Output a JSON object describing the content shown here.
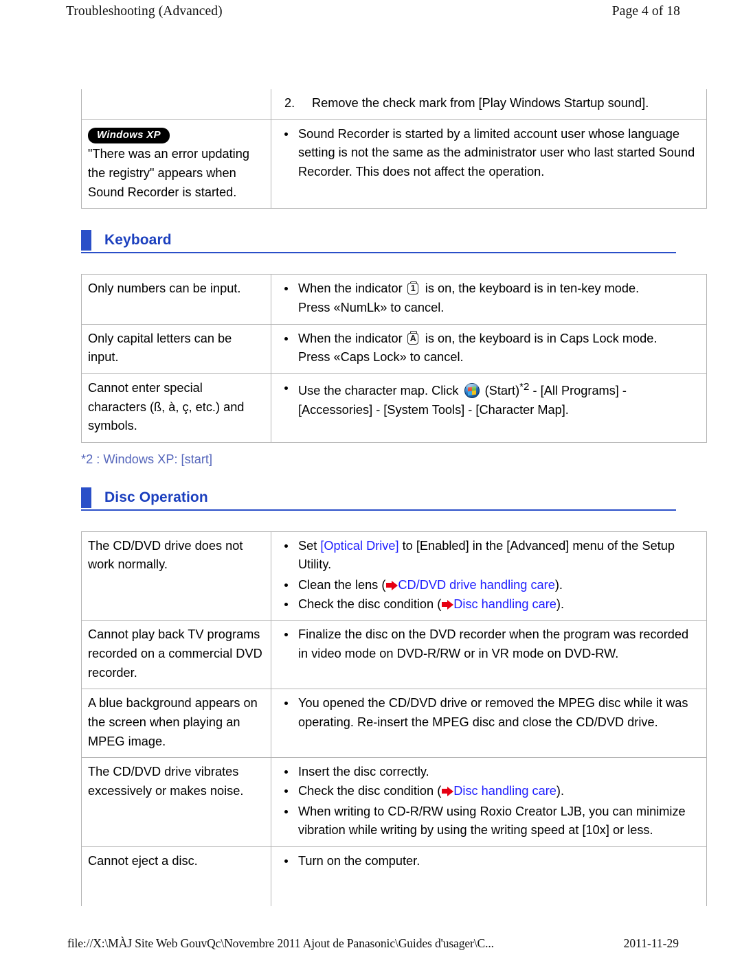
{
  "header": {
    "title": "Troubleshooting (Advanced)",
    "page_label": "Page 4 of 18"
  },
  "footer": {
    "path": "file://X:\\MÀJ Site Web GouvQc\\Novembre 2011 Ajout de Panasonic\\Guides d'usager\\C...",
    "date": "2011-11-29"
  },
  "sound_table": {
    "row1": {
      "symptom": "",
      "number": "2.",
      "fix": "Remove the check mark from [Play Windows Startup sound]."
    },
    "row2": {
      "badge": "Windows XP",
      "symptom": "\"There was an error updating the registry\" appears when Sound Recorder is started.",
      "fix": "Sound Recorder is started by a limited account user whose language setting is not the same as the administrator user who last started Sound Recorder. This does not affect the operation."
    }
  },
  "keyboard_section": {
    "heading": "Keyboard",
    "rows": [
      {
        "symptom": "Only numbers can be input.",
        "fix_pre": "When the indicator",
        "indicator": "1",
        "fix_post": "is on, the keyboard is in ten-key mode.",
        "fix_line2": "Press «NumLk» to cancel."
      },
      {
        "symptom": "Only capital letters can be input.",
        "fix_pre": "When the indicator",
        "indicator": "A",
        "fix_post": "is on, the keyboard is in Caps Lock mode.",
        "fix_line2": "Press «Caps Lock» to cancel."
      },
      {
        "symptom": "Cannot enter special characters (ß, à, ç, etc.) and symbols.",
        "fix_pre": "Use the character map. Click",
        "fix_start": "(Start)",
        "fix_sup": "*2",
        "fix_post": " - [All Programs] - [Accessories] - [System Tools] - [Character Map].",
        "fix_line2": ""
      }
    ],
    "footnote": "*2 : Windows XP: [start]"
  },
  "disc_section": {
    "heading": "Disc Operation",
    "rows": [
      {
        "symptom": "The CD/DVD drive does not work normally.",
        "bullets": [
          {
            "kind": "link-inline",
            "pre": "Set ",
            "link": "[Optical Drive]",
            "post": " to [Enabled] in the [Advanced] menu of the Setup Utility."
          },
          {
            "kind": "jump",
            "pre": "Clean the lens (",
            "link": "CD/DVD drive handling care",
            "post": ")."
          },
          {
            "kind": "jump",
            "pre": "Check the disc condition (",
            "link": "Disc handling care",
            "post": ")."
          }
        ]
      },
      {
        "symptom": "Cannot play back TV programs recorded on a commercial DVD recorder.",
        "bullets": [
          {
            "kind": "plain",
            "text": "Finalize the disc on the DVD recorder when the program was recorded in video mode on DVD-R/RW or in VR mode on DVD-RW."
          }
        ]
      },
      {
        "symptom": "A blue background appears on the screen when playing an MPEG image.",
        "bullets": [
          {
            "kind": "plain",
            "text": "You opened the CD/DVD drive or removed the MPEG disc while it was operating. Re-insert the MPEG disc and close the CD/DVD drive."
          }
        ]
      },
      {
        "symptom": "The CD/DVD drive vibrates excessively or makes noise.",
        "bullets": [
          {
            "kind": "plain",
            "text": "Insert the disc correctly."
          },
          {
            "kind": "jump",
            "pre": "Check the disc condition (",
            "link": "Disc handling care",
            "post": ")."
          },
          {
            "kind": "plain",
            "text": "When writing to CD-R/RW using Roxio Creator LJB, you can minimize vibration while writing by using the writing speed at [10x] or less."
          }
        ]
      },
      {
        "symptom": "Cannot eject a disc.",
        "bullets": [
          {
            "kind": "plain",
            "text": "Turn on the computer."
          }
        ]
      }
    ]
  },
  "colors": {
    "heading_blue": "#2a4fc8",
    "link_blue": "#1d1dff",
    "footnote_blue": "#5566bb",
    "arrow_red": "#e60012",
    "table_border": "#b4b4b4"
  }
}
